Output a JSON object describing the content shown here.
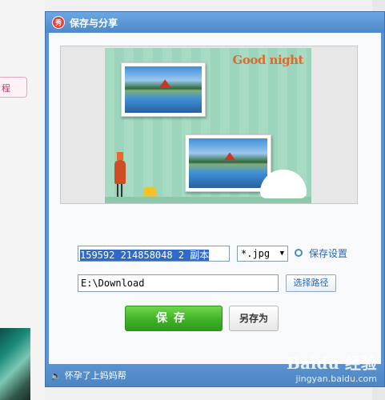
{
  "background": {
    "left_tab_label": "程"
  },
  "dialog": {
    "title": "保存与分享",
    "app_icon_glyph": "秀"
  },
  "preview": {
    "goodnight_text": "Good night"
  },
  "controls": {
    "filename_value": "159592 214858048 2 副本",
    "file_type": "*.jpg",
    "save_settings_link": "保存设置",
    "path_value": "E:\\Download",
    "choose_path_label": "选择路径",
    "save_label": "保存",
    "save_as_label": "另存为"
  },
  "statusbar": {
    "speaker_glyph": "🔈",
    "message": "怀孕了上妈妈帮"
  },
  "watermark": {
    "line1": "Baidu 经验",
    "line2": "jingyan.baidu.com"
  },
  "colors": {
    "dialog_blue": "#5a93cf",
    "save_green": "#3fb226",
    "link_blue": "#2b65b8"
  }
}
